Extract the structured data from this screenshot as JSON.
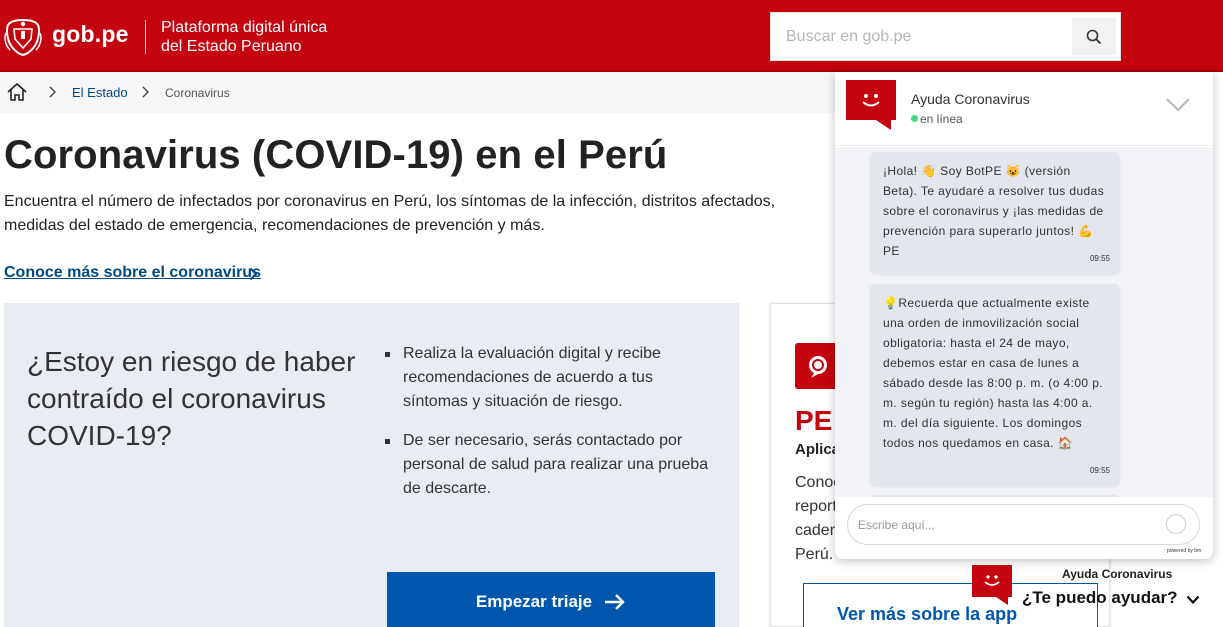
{
  "header": {
    "logo_text": "gob.pe",
    "platform_line1": "Plataforma digital única",
    "platform_line2": "del Estado Peruano",
    "search_placeholder": "Buscar en gob.pe",
    "brand_color": "#c4040e"
  },
  "breadcrumb": {
    "items": [
      "El Estado",
      "Coronavirus"
    ]
  },
  "main": {
    "title": "Coronavirus (COVID-19) en el Perú",
    "intro": "Encuentra el número de infectados por coronavirus en Perú, los síntomas de la infección, distritos afectados, medidas del estado de emergencia, recomendaciones de prevención y más.",
    "more_link": "Conoce más sobre el coronavirus"
  },
  "risk_card": {
    "title": "¿Estoy en riesgo de haber contraído el coronavirus COVID-19?",
    "bullets": [
      "Realiza la evaluación digital y recibe recomendaciones de acuerdo a tus síntomas y situación de riesgo.",
      "De ser necesario, serás contactado por personal de salud para realizar una prueba de descarte."
    ],
    "button": "Empezar triaje"
  },
  "app_card": {
    "name": "PE",
    "subtitle": "Aplica",
    "desc_lines": [
      "Conoc",
      "report",
      "caden",
      "Perú."
    ],
    "button": "Ver más sobre la app"
  },
  "chat": {
    "title": "Ayuda Coronavirus",
    "status": "en línea",
    "messages": [
      {
        "text": "¡Hola! 👋 Soy BotPE 😺 (versión Beta). Te ayudaré a resolver tus dudas sobre el coronavirus y ¡las medidas de prevención para superarlo juntos! 💪PE",
        "time": "09:55"
      },
      {
        "text": "💡Recuerda que actualmente existe una orden de inmovilización social obligatoria: hasta el 24 de mayo, debemos estar en casa de lunes a sábado desde las 8:00 p. m. (o 4:00 p. m. según tu región) hasta las 4:00 a. m. del día siguiente. Los domingos todos nos quedamos en casa. 🏠",
        "time": "09:55"
      }
    ],
    "input_placeholder": "Escribe aquí...",
    "powered": "powered by bm"
  },
  "launcher": {
    "title": "Ayuda Coronavirus",
    "question": "¿Te puedo ayudar?"
  }
}
